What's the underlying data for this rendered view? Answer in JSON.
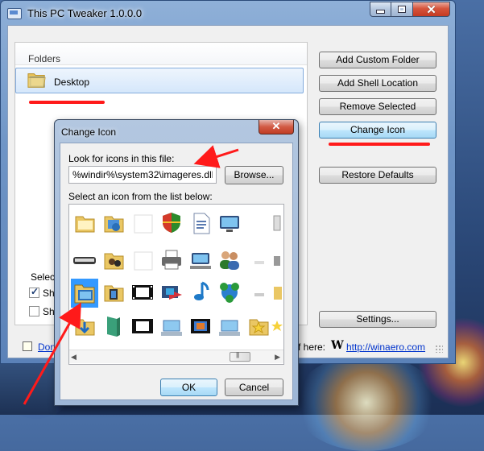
{
  "window": {
    "title": "This PC Tweaker 1.0.0.0",
    "controls": {
      "minimize": "minimize",
      "maximize": "maximize",
      "close": "✕"
    }
  },
  "folders": {
    "header": "Folders",
    "items": [
      {
        "label": "Desktop"
      }
    ]
  },
  "buttons": {
    "add_custom_folder": "Add Custom Folder",
    "add_shell_location": "Add Shell Location",
    "remove_selected": "Remove Selected",
    "change_icon": "Change Icon",
    "restore_defaults": "Restore Defaults",
    "settings": "Settings..."
  },
  "options": {
    "select_label": "Select",
    "checkbox_1_label": "Sh",
    "checkbox_1_checked": true,
    "checkbox_2_label": "Sh",
    "checkbox_2_checked": false
  },
  "footer": {
    "left_link": "Don",
    "right_text": "f here:",
    "logo_letter": "W",
    "winaero_link": "http://winaero.com",
    "grip_text": "..."
  },
  "dialog": {
    "title": "Change Icon",
    "close": "✕",
    "look_label": "Look for icons in this file:",
    "path_value": "%windir%\\system32\\imageres.dll",
    "browse": "Browse...",
    "select_icon_label": "Select an icon from the list below:",
    "ok": "OK",
    "cancel": "Cancel"
  },
  "icons": [
    "folder-icon",
    "pictures-folder-icon",
    "blank-icon",
    "security-shield-icon",
    "document-icon",
    "monitor-icon",
    "blank-icon",
    "scrollbar-icon",
    "keyboard-icon",
    "people-folder-icon",
    "blank-icon",
    "printer-icon",
    "network-computer-icon",
    "users-icon",
    "blank-icon",
    "drive-icon",
    "folder-selected-icon",
    "video-folder-icon",
    "film-strip-icon",
    "programs-icon",
    "music-icon",
    "network-globe-icon",
    "blank-icon",
    "drive-small-icon",
    "downloads-folder-icon",
    "book-icon",
    "film-strip-icon",
    "computer-drive-icon",
    "filmstrip-color-icon",
    "computer-drive-icon",
    "favorites-folder-icon",
    "star-icon"
  ],
  "colors": {
    "accent_red": "#ff1a1a",
    "selection_blue": "#3399ff",
    "link_blue": "#0033cc"
  }
}
